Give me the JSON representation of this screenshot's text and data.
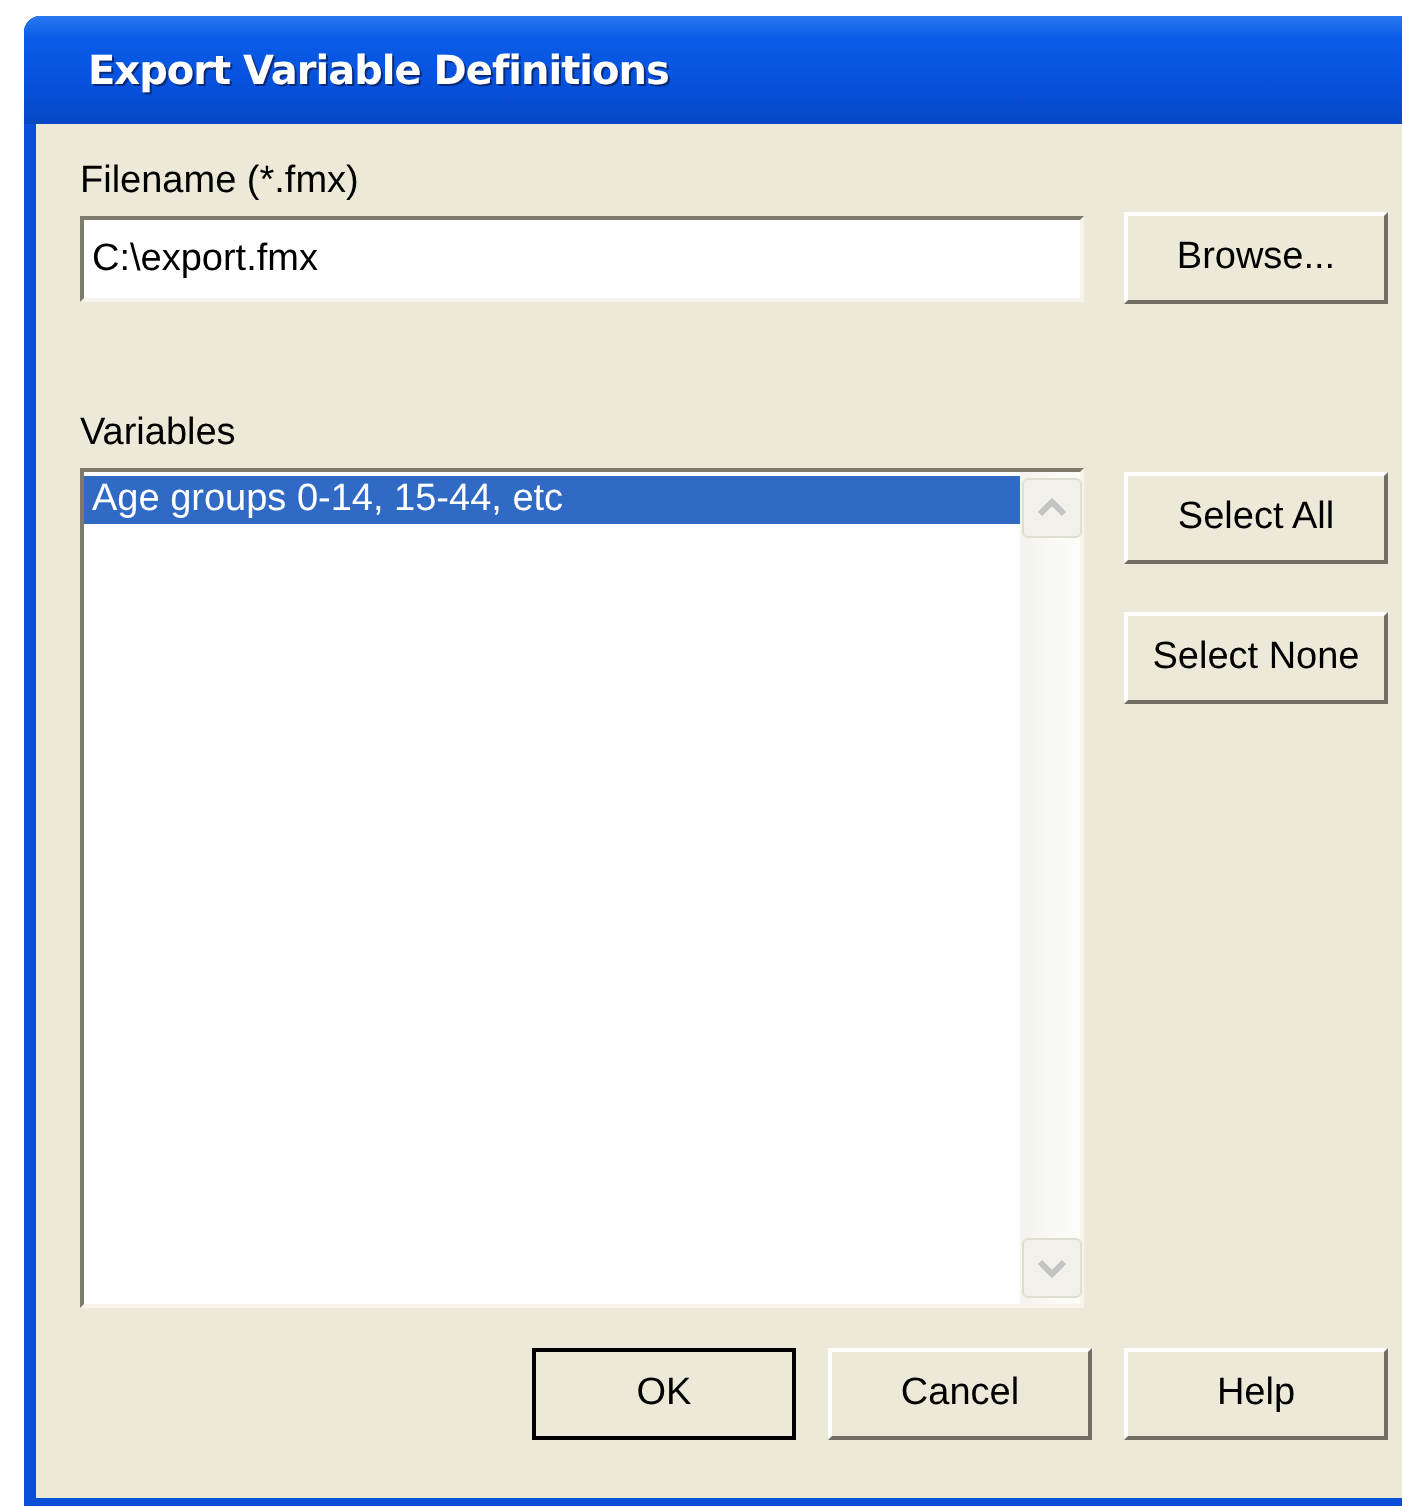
{
  "window": {
    "title": "Export Variable Definitions"
  },
  "filename": {
    "label": "Filename (*.fmx)",
    "value": "C:\\export.fmx",
    "browse_button": "Browse..."
  },
  "variables": {
    "label": "Variables",
    "items": [
      {
        "text": "Age groups 0-14, 15-44, etc",
        "selected": true
      }
    ],
    "buttons": [
      "Select All",
      "Select None"
    ]
  },
  "buttons": [
    {
      "label": "OK",
      "default": true
    },
    {
      "label": "Cancel",
      "default": false
    },
    {
      "label": "Help",
      "default": false
    }
  ]
}
